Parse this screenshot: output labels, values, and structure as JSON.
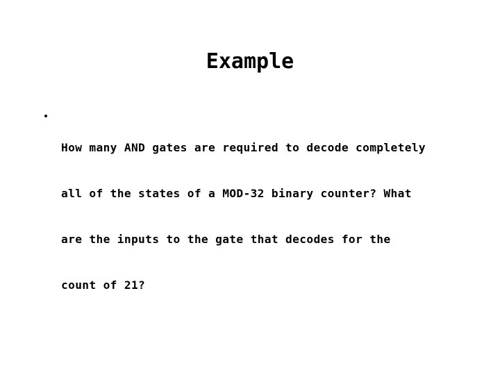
{
  "slide": {
    "background_color": "#ffffff",
    "text_color": "#000000",
    "title": "Example",
    "bullets": [
      {
        "marker": "bullet-dot",
        "lines": [
          "How many AND gates are required to decode completely",
          "all of the states of a MOD-32 binary counter? What",
          "are the inputs to the gate that decodes for the",
          "count of 21?"
        ],
        "full_text": "How many AND gates are required to decode completely all of the states of a MOD-32 binary counter? What are the inputs to the gate that decodes for the count of 21?"
      }
    ]
  }
}
